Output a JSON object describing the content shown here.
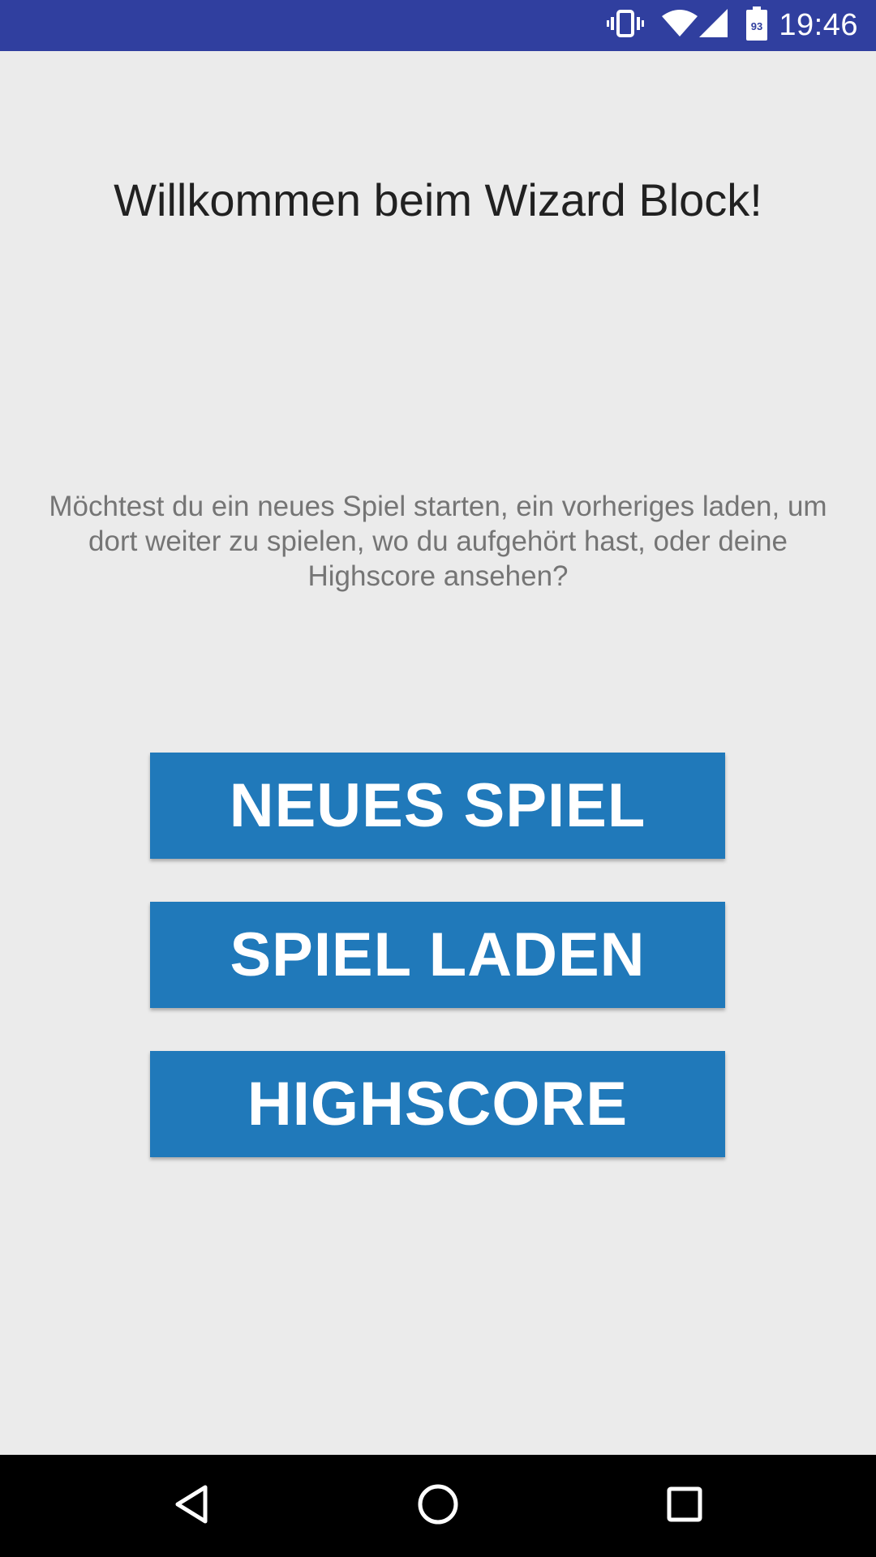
{
  "status_bar": {
    "time": "19:46",
    "battery_level": "93",
    "icons": [
      "vibrate-icon",
      "wifi-icon",
      "cell-signal-icon",
      "battery-icon"
    ]
  },
  "main": {
    "title": "Willkommen beim Wizard Block!",
    "description": "Möchtest du ein neues Spiel starten, ein vorheriges laden, um dort weiter zu spielen, wo du aufgehört hast, oder deine Highscore ansehen?",
    "buttons": {
      "new_game": "NEUES SPIEL",
      "load_game": "SPIEL LADEN",
      "highscore": "HIGHSCORE"
    }
  },
  "nav_bar": {
    "icons": [
      "back-icon",
      "home-icon",
      "recents-icon"
    ]
  },
  "colors": {
    "status_bar": "#303f9f",
    "background": "#ebebeb",
    "button": "#2079ba",
    "button_text": "#ffffff",
    "title_text": "#212121",
    "description_text": "#757575",
    "nav_bar": "#000000"
  }
}
